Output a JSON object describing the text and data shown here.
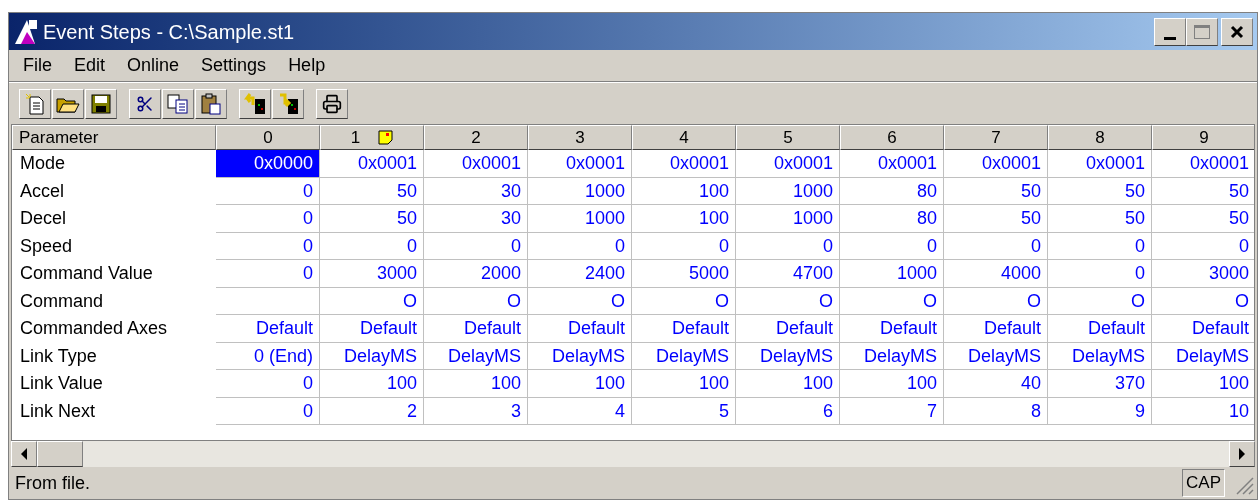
{
  "window": {
    "title": "Event Steps - C:\\Sample.st1"
  },
  "menu": [
    {
      "label": "File"
    },
    {
      "label": "Edit"
    },
    {
      "label": "Online"
    },
    {
      "label": "Settings"
    },
    {
      "label": "Help"
    }
  ],
  "grid": {
    "corner": "Parameter",
    "columns": [
      {
        "label": "0",
        "has_note": false
      },
      {
        "label": "1",
        "has_note": true
      },
      {
        "label": "2",
        "has_note": false
      },
      {
        "label": "3",
        "has_note": false
      },
      {
        "label": "4",
        "has_note": false
      },
      {
        "label": "5",
        "has_note": false
      },
      {
        "label": "6",
        "has_note": false
      },
      {
        "label": "7",
        "has_note": false
      },
      {
        "label": "8",
        "has_note": false
      },
      {
        "label": "9",
        "has_note": false
      }
    ],
    "rows": [
      {
        "name": "Mode",
        "cells": [
          {
            "text": "0x0000",
            "selected": true
          },
          {
            "text": "0x0001",
            "selected": false
          },
          {
            "text": "0x0001",
            "selected": false
          },
          {
            "text": "0x0001",
            "selected": false
          },
          {
            "text": "0x0001",
            "selected": false
          },
          {
            "text": "0x0001",
            "selected": false
          },
          {
            "text": "0x0001",
            "selected": false
          },
          {
            "text": "0x0001",
            "selected": false
          },
          {
            "text": "0x0001",
            "selected": false
          },
          {
            "text": "0x0001",
            "selected": false
          }
        ]
      },
      {
        "name": "Accel",
        "cells": [
          {
            "text": "0",
            "selected": false
          },
          {
            "text": "50",
            "selected": false
          },
          {
            "text": "30",
            "selected": false
          },
          {
            "text": "1000",
            "selected": false
          },
          {
            "text": "100",
            "selected": false
          },
          {
            "text": "1000",
            "selected": false
          },
          {
            "text": "80",
            "selected": false
          },
          {
            "text": "50",
            "selected": false
          },
          {
            "text": "50",
            "selected": false
          },
          {
            "text": "50",
            "selected": false
          }
        ]
      },
      {
        "name": "Decel",
        "cells": [
          {
            "text": "0",
            "selected": false
          },
          {
            "text": "50",
            "selected": false
          },
          {
            "text": "30",
            "selected": false
          },
          {
            "text": "1000",
            "selected": false
          },
          {
            "text": "100",
            "selected": false
          },
          {
            "text": "1000",
            "selected": false
          },
          {
            "text": "80",
            "selected": false
          },
          {
            "text": "50",
            "selected": false
          },
          {
            "text": "50",
            "selected": false
          },
          {
            "text": "50",
            "selected": false
          }
        ]
      },
      {
        "name": "Speed",
        "cells": [
          {
            "text": "0",
            "selected": false
          },
          {
            "text": "0",
            "selected": false
          },
          {
            "text": "0",
            "selected": false
          },
          {
            "text": "0",
            "selected": false
          },
          {
            "text": "0",
            "selected": false
          },
          {
            "text": "0",
            "selected": false
          },
          {
            "text": "0",
            "selected": false
          },
          {
            "text": "0",
            "selected": false
          },
          {
            "text": "0",
            "selected": false
          },
          {
            "text": "0",
            "selected": false
          }
        ]
      },
      {
        "name": "Command Value",
        "cells": [
          {
            "text": "0",
            "selected": false
          },
          {
            "text": "3000",
            "selected": false
          },
          {
            "text": "2000",
            "selected": false
          },
          {
            "text": "2400",
            "selected": false
          },
          {
            "text": "5000",
            "selected": false
          },
          {
            "text": "4700",
            "selected": false
          },
          {
            "text": "1000",
            "selected": false
          },
          {
            "text": "4000",
            "selected": false
          },
          {
            "text": "0",
            "selected": false
          },
          {
            "text": "3000",
            "selected": false
          }
        ]
      },
      {
        "name": "Command",
        "cells": [
          {
            "text": "",
            "selected": false
          },
          {
            "text": "O",
            "selected": false
          },
          {
            "text": "O",
            "selected": false
          },
          {
            "text": "O",
            "selected": false
          },
          {
            "text": "O",
            "selected": false
          },
          {
            "text": "O",
            "selected": false
          },
          {
            "text": "O",
            "selected": false
          },
          {
            "text": "O",
            "selected": false
          },
          {
            "text": "O",
            "selected": false
          },
          {
            "text": "O",
            "selected": false
          }
        ]
      },
      {
        "name": "Commanded Axes",
        "cells": [
          {
            "text": "Default",
            "selected": false
          },
          {
            "text": "Default",
            "selected": false
          },
          {
            "text": "Default",
            "selected": false
          },
          {
            "text": "Default",
            "selected": false
          },
          {
            "text": "Default",
            "selected": false
          },
          {
            "text": "Default",
            "selected": false
          },
          {
            "text": "Default",
            "selected": false
          },
          {
            "text": "Default",
            "selected": false
          },
          {
            "text": "Default",
            "selected": false
          },
          {
            "text": "Default",
            "selected": false
          }
        ]
      },
      {
        "name": "Link Type",
        "cells": [
          {
            "text": "0 (End)",
            "selected": false
          },
          {
            "text": "DelayMS",
            "selected": false
          },
          {
            "text": "DelayMS",
            "selected": false
          },
          {
            "text": "DelayMS",
            "selected": false
          },
          {
            "text": "DelayMS",
            "selected": false
          },
          {
            "text": "DelayMS",
            "selected": false
          },
          {
            "text": "DelayMS",
            "selected": false
          },
          {
            "text": "DelayMS",
            "selected": false
          },
          {
            "text": "DelayMS",
            "selected": false
          },
          {
            "text": "DelayMS",
            "selected": false
          }
        ]
      },
      {
        "name": "Link Value",
        "cells": [
          {
            "text": "0",
            "selected": false
          },
          {
            "text": "100",
            "selected": false
          },
          {
            "text": "100",
            "selected": false
          },
          {
            "text": "100",
            "selected": false
          },
          {
            "text": "100",
            "selected": false
          },
          {
            "text": "100",
            "selected": false
          },
          {
            "text": "100",
            "selected": false
          },
          {
            "text": "40",
            "selected": false
          },
          {
            "text": "370",
            "selected": false
          },
          {
            "text": "100",
            "selected": false
          }
        ]
      },
      {
        "name": "Link Next",
        "cells": [
          {
            "text": "0",
            "selected": false
          },
          {
            "text": "2",
            "selected": false
          },
          {
            "text": "3",
            "selected": false
          },
          {
            "text": "4",
            "selected": false
          },
          {
            "text": "5",
            "selected": false
          },
          {
            "text": "6",
            "selected": false
          },
          {
            "text": "7",
            "selected": false
          },
          {
            "text": "8",
            "selected": false
          },
          {
            "text": "9",
            "selected": false
          },
          {
            "text": "10",
            "selected": false
          }
        ]
      }
    ]
  },
  "status_bar": {
    "message": "From file.",
    "indicator": "CAP"
  }
}
